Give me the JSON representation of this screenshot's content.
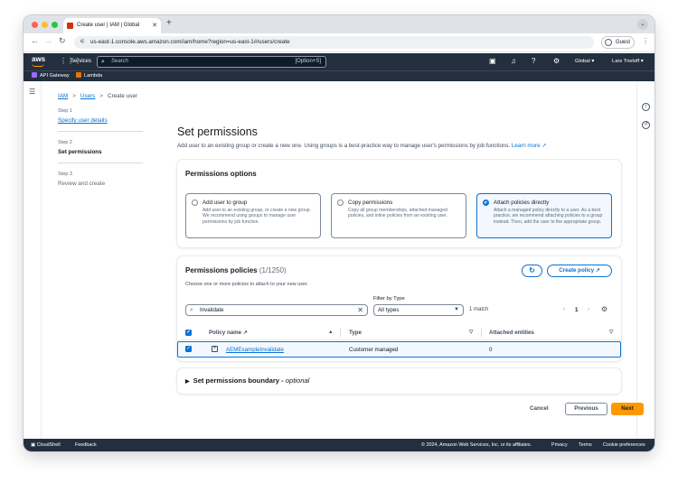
{
  "browser": {
    "tab_title": "Create user | IAM | Global",
    "url": "us-east-1.console.aws.amazon.com/iam/home?region=us-east-1#/users/create",
    "profile": "Guest"
  },
  "awsnav": {
    "logo": "aws",
    "services": "Services",
    "search_placeholder": "Search",
    "search_shortcut": "[Option+S]",
    "region": "Global",
    "user": "Lars Trieloff",
    "favorites": [
      "API Gateway",
      "Lambda"
    ]
  },
  "breadcrumb": [
    "IAM",
    "Users",
    "Create user"
  ],
  "steps": [
    {
      "num": "Step 1",
      "title": "Specify user details"
    },
    {
      "num": "Step 2",
      "title": "Set permissions"
    },
    {
      "num": "Step 3",
      "title": "Review and create"
    }
  ],
  "page": {
    "title": "Set permissions",
    "description": "Add user to an existing group or create a new one. Using groups is a best-practice way to manage user's permissions by job functions.",
    "learn_more": "Learn more"
  },
  "permissions_options": {
    "heading": "Permissions options",
    "options": [
      {
        "title": "Add user to group",
        "desc": "Add user to an existing group, or create a new group. We recommend using groups to manage user permissions by job function."
      },
      {
        "title": "Copy permissions",
        "desc": "Copy all group memberships, attached managed policies, and inline policies from an existing user."
      },
      {
        "title": "Attach policies directly",
        "desc": "Attach a managed policy directly to a user. As a best practice, we recommend attaching policies to a group instead. Then, add the user to the appropriate group."
      }
    ],
    "selected": "Attach policies directly"
  },
  "policies": {
    "heading": "Permissions policies",
    "count": "(1/1250)",
    "description": "Choose one or more policies to attach to your new user.",
    "refresh_icon": "refresh-icon",
    "create_policy": "Create policy",
    "search_value": "Invalidate",
    "filter_label": "Filter by Type",
    "filter_value": "All types",
    "matches": "1 match",
    "page": "1",
    "columns": [
      "Policy name",
      "Type",
      "Attached entities"
    ],
    "rows": [
      {
        "name": "AEMExampleInvalidate",
        "type": "Customer managed",
        "attached": "0",
        "checked": true
      }
    ]
  },
  "boundary": {
    "label": "Set permissions boundary - ",
    "optional": "optional"
  },
  "actions": {
    "cancel": "Cancel",
    "previous": "Previous",
    "next": "Next"
  },
  "footer": {
    "cloudshell": "CloudShell",
    "feedback": "Feedback",
    "copyright": "© 2024, Amazon Web Services, Inc. or its affiliates.",
    "privacy": "Privacy",
    "terms": "Terms",
    "cookies": "Cookie preferences"
  },
  "colors": {
    "accent": "#0972d3",
    "primary_button": "#ff9900",
    "nav_bg": "#232f3e"
  }
}
